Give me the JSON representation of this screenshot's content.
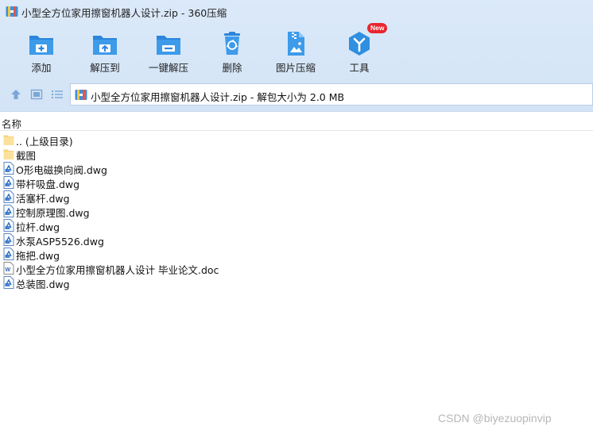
{
  "window": {
    "title": "小型全方位家用擦窗机器人设计.zip - 360压缩"
  },
  "toolbar": {
    "add_label": "添加",
    "extract_to_label": "解压到",
    "one_click_extract_label": "一键解压",
    "delete_label": "删除",
    "image_compress_label": "图片压缩",
    "tools_label": "工具",
    "tools_badge": "New"
  },
  "address_bar": {
    "text": "小型全方位家用擦窗机器人设计.zip - 解包大小为 2.0 MB"
  },
  "file_list": {
    "column_name": "名称",
    "items": [
      {
        "name": ".. (上级目录)",
        "type": "folder"
      },
      {
        "name": "截图",
        "type": "folder"
      },
      {
        "name": "O形电磁换向阀.dwg",
        "type": "dwg"
      },
      {
        "name": "带杆吸盘.dwg",
        "type": "dwg"
      },
      {
        "name": "活塞杆.dwg",
        "type": "dwg"
      },
      {
        "name": "控制原理图.dwg",
        "type": "dwg"
      },
      {
        "name": "拉杆.dwg",
        "type": "dwg"
      },
      {
        "name": "水泵ASP5526.dwg",
        "type": "dwg"
      },
      {
        "name": "拖把.dwg",
        "type": "dwg"
      },
      {
        "name": "小型全方位家用擦窗机器人设计 毕业论文.doc",
        "type": "doc"
      },
      {
        "name": "总装图.dwg",
        "type": "dwg"
      }
    ]
  },
  "watermark": "CSDN @biyezuopinvip",
  "colors": {
    "chrome_bg": "#d6e6f8",
    "icon_blue": "#2f8fe0",
    "badge_red": "#e8252e"
  }
}
